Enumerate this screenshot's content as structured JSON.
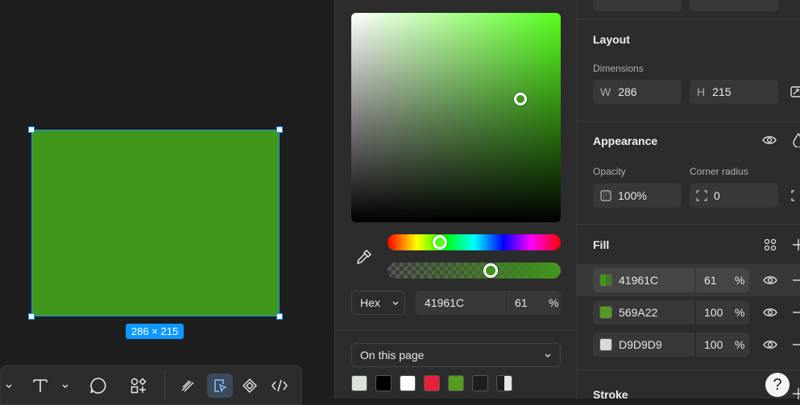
{
  "canvas": {
    "fill_color": "#41961C",
    "dimension_badge": "286 × 215"
  },
  "toolbar": {
    "items": [
      "chevron-down-icon",
      "text-icon",
      "chevron-down-icon",
      "comment-icon",
      "actions-icon",
      "draw-icon",
      "dev-select-icon",
      "component-icon",
      "code-icon"
    ]
  },
  "picker": {
    "hex_mode": "Hex",
    "hex_value": "41961C",
    "opacity_value": "61",
    "opacity_unit": "%",
    "page_select": "On this page",
    "swatches": [
      "#d9e3d9",
      "#000000",
      "#ffffff",
      "#e8213a",
      "#569a22",
      "#1e1e1e",
      "#777777"
    ]
  },
  "props": {
    "layout": {
      "title": "Layout",
      "dimensions_label": "Dimensions",
      "w_label": "W",
      "w_value": "286",
      "h_label": "H",
      "h_value": "215"
    },
    "appearance": {
      "title": "Appearance",
      "opacity_label": "Opacity",
      "opacity_value": "100%",
      "corner_label": "Corner radius",
      "corner_value": "0"
    },
    "fill": {
      "title": "Fill",
      "rows": [
        {
          "hex": "41961C",
          "pct": "61",
          "unit": "%",
          "color": "#41961C"
        },
        {
          "hex": "569A22",
          "pct": "100",
          "unit": "%",
          "color": "#569A22"
        },
        {
          "hex": "D9D9D9",
          "pct": "100",
          "unit": "%",
          "color": "#D9D9D9"
        }
      ]
    },
    "stroke": {
      "title": "Stroke"
    },
    "help_label": "?"
  }
}
